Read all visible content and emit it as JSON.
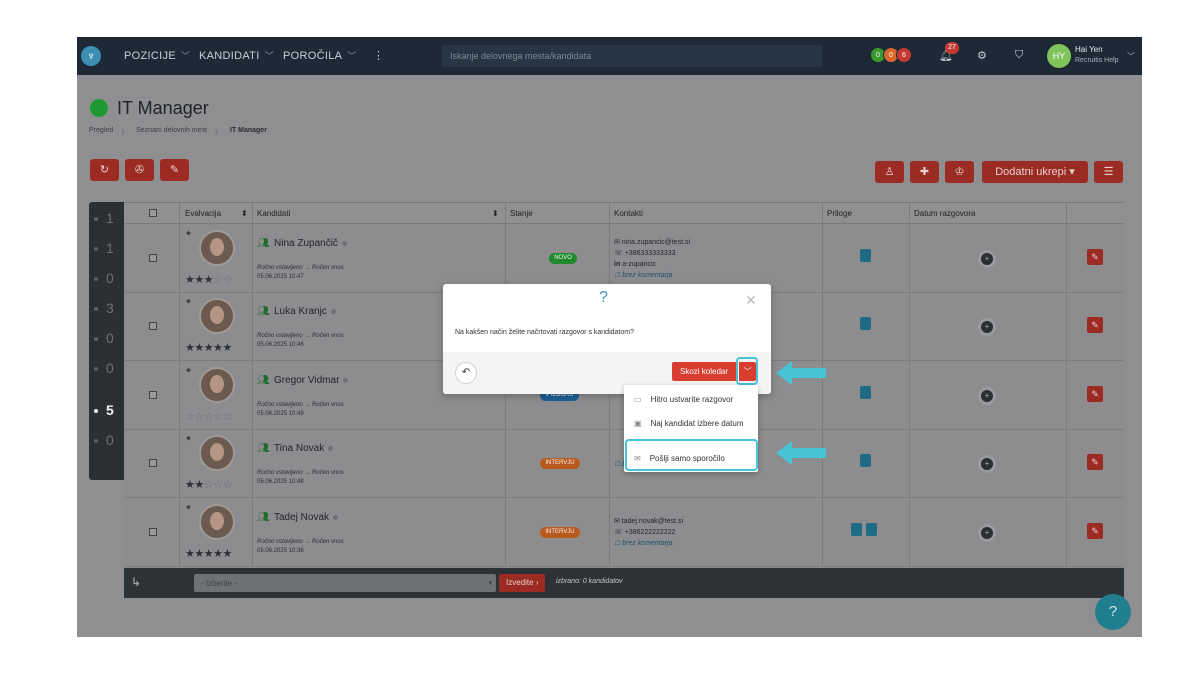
{
  "nav": {
    "items": [
      {
        "label": "POZICIJE"
      },
      {
        "label": "KANDIDATI"
      },
      {
        "label": "POROČILA"
      }
    ],
    "search_placeholder": "Iskanje delovnega mesta/kandidata",
    "counters": [
      {
        "value": "0",
        "color": "#3a9a2e"
      },
      {
        "value": "0",
        "color": "#d9682a"
      },
      {
        "value": "6",
        "color": "#c43a32"
      }
    ],
    "notifications": "27",
    "user": {
      "initials": "HY",
      "name": "Hai Yen",
      "org": "Recruitis Help"
    }
  },
  "page": {
    "title": "IT Manager",
    "breadcrumb": [
      "Pregled",
      "Seznam delovnih mest",
      "IT Manager"
    ],
    "actions_label": "Dodatni ukrepi"
  },
  "table": {
    "headers": {
      "evaluation": "Evalvacija",
      "candidates": "Kandidati",
      "status": "Stanje",
      "contacts": "Kontakti",
      "attachments": "Priloge",
      "interview_date": "Datum razgovora"
    },
    "rows": [
      {
        "name": "Nina Zupančič",
        "source": "Ročno vstavljeno → Ročen vnos",
        "date": "05.06.2025 10:47",
        "rating": 3,
        "status": "NOVO",
        "status_color": "#1f8a2e",
        "email": "nina.zupancic@test.si",
        "phone": "+386333333333",
        "linkedin": "a-zupancic",
        "comment": "brez komentarja",
        "docs": 1
      },
      {
        "name": "Luka Kranjc",
        "source": "Ročno vstavljeno → Ročen vnos",
        "date": "05.06.2025 10:46",
        "rating": 5,
        "status": "",
        "status_color": "",
        "email": "",
        "phone": "",
        "linkedin": "",
        "comment": "",
        "docs": 1
      },
      {
        "name": "Gregor Vidmar",
        "source": "Ročno vstavljeno → Ročen vnos",
        "date": "05.06.2025 10:48",
        "rating": 0,
        "status": "V IZBORU",
        "status_color": "#1f5f94",
        "email": "",
        "phone": "",
        "linkedin": "",
        "comment": "",
        "docs": 1
      },
      {
        "name": "Tina Novak",
        "source": "Ročno vstavljeno → Ročen vnos",
        "date": "05.06.2025 10:48",
        "rating": 2,
        "status": "INTERVJU",
        "status_color": "#b85a1e",
        "email": "",
        "phone": "",
        "linkedin": "",
        "comment": "brez komentarja",
        "docs": 1
      },
      {
        "name": "Tadej Novak",
        "source": "Ročno vstavljeno → Ročen vnos",
        "date": "05.06.2025 10:36",
        "rating": 5,
        "status": "INTERVJU",
        "status_color": "#b85a1e",
        "email": "tadej.novak@test.si",
        "phone": "+386222222222",
        "linkedin": "",
        "comment": "brez komentarja",
        "docs": 2
      }
    ]
  },
  "pipeline": {
    "counts": [
      "1",
      "1",
      "0",
      "3",
      "0",
      "0",
      "5",
      "0"
    ],
    "selected_index": 6
  },
  "bulk": {
    "select_placeholder": "- Izberite -",
    "execute_label": "Izvedite",
    "selected_text": "izbrano: 0 kandidatov"
  },
  "modal": {
    "icon": "?",
    "question": "Na kakšen način želite načrtovati razgovor s kandidatom?",
    "primary_label": "Skozi koledar",
    "menu": [
      {
        "label": "Hitro ustvarite razgovor",
        "icon": "calendar-icon"
      },
      {
        "label": "Naj kandidat izbere datum",
        "icon": "calendar-user-icon"
      },
      {
        "label": "Pošlji samo sporočilo",
        "icon": "envelope-icon"
      }
    ]
  },
  "help_label": "?",
  "highlight_color": "#46c3d4"
}
